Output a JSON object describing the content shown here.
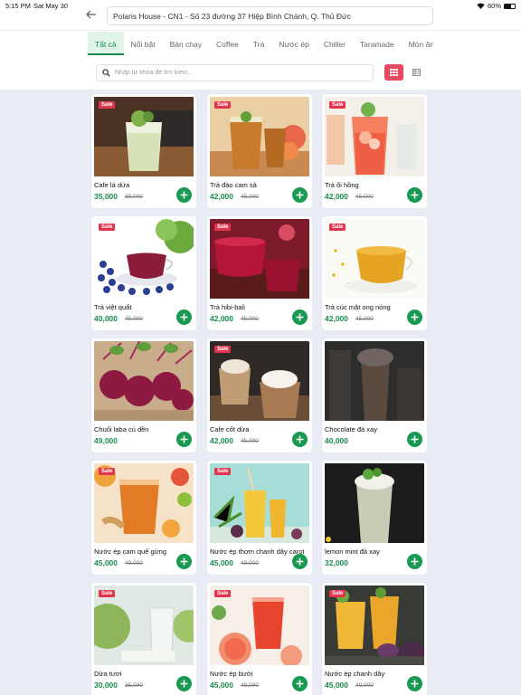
{
  "status_bar": {
    "time": "5:15 PM",
    "date": "Sat May 30",
    "battery": "60%",
    "battery_level": 0.6
  },
  "header": {
    "back_icon": "arrow-left-icon",
    "address": "Polaris House - CN1 - Số 23 đường 37 Hiệp Bình Chánh, Q. Thủ Đức"
  },
  "tabs": [
    {
      "label": "Tất cả",
      "active": true
    },
    {
      "label": "Nổi bật",
      "active": false
    },
    {
      "label": "Bán chạy",
      "active": false
    },
    {
      "label": "Coffee",
      "active": false
    },
    {
      "label": "Trà",
      "active": false
    },
    {
      "label": "Nước ép",
      "active": false
    },
    {
      "label": "Chiller",
      "active": false
    },
    {
      "label": "Taramade",
      "active": false
    },
    {
      "label": "Món ăn",
      "active": false
    }
  ],
  "search": {
    "placeholder": "Nhập từ khóa để tìm kiếm...",
    "value": ""
  },
  "view_toggle": {
    "grid_icon": "grid-view-icon",
    "list_icon": "list-view-icon",
    "active": "grid",
    "active_color": "#e84a60"
  },
  "colors": {
    "accent": "#1a8b4d",
    "sale": "#e2344e",
    "background": "#eaecf5"
  },
  "sale_label": "Sale",
  "products": [
    {
      "name": "Cafe lá dứa",
      "price": "35,000",
      "old_price": "39,000",
      "sale": true,
      "image": "pandan-coffee"
    },
    {
      "name": "Trà đào cam sả",
      "price": "42,000",
      "old_price": "45,000",
      "sale": true,
      "image": "peach-tea"
    },
    {
      "name": "Trà ổi hồng",
      "price": "42,000",
      "old_price": "45,000",
      "sale": true,
      "image": "guava-tea"
    },
    {
      "name": "Trà việt quất",
      "price": "40,000",
      "old_price": "45,000",
      "sale": true,
      "image": "blueberry-tea"
    },
    {
      "name": "Trà hibi-bali",
      "price": "42,000",
      "old_price": "45,000",
      "sale": true,
      "image": "hibiscus-tea"
    },
    {
      "name": "Trà cúc mật ong nóng",
      "price": "42,000",
      "old_price": "45,000",
      "sale": true,
      "image": "chamomile-tea"
    },
    {
      "name": "Chuối laba củ dền",
      "price": "49,000",
      "old_price": "",
      "sale": false,
      "image": "beetroot"
    },
    {
      "name": "Cafe cốt dừa",
      "price": "42,000",
      "old_price": "45,000",
      "sale": true,
      "image": "coconut-coffee"
    },
    {
      "name": "Chocolate đá xay",
      "price": "40,000",
      "old_price": "",
      "sale": false,
      "image": "chocolate-frappe"
    },
    {
      "name": "Nước ép cam quế gừng",
      "price": "45,000",
      "old_price": "49,000",
      "sale": true,
      "image": "orange-ginger-juice"
    },
    {
      "name": "Nước ép thơm chanh dây carot",
      "price": "45,000",
      "old_price": "49,000",
      "sale": true,
      "image": "pineapple-juice"
    },
    {
      "name": "lemon mint đá xay",
      "price": "32,000",
      "old_price": "",
      "sale": false,
      "image": "lemon-mint-frappe"
    },
    {
      "name": "Dừa tươi",
      "price": "30,000",
      "old_price": "35,000",
      "sale": true,
      "image": "fresh-coconut"
    },
    {
      "name": "Nước ép bưởi",
      "price": "45,000",
      "old_price": "49,000",
      "sale": true,
      "image": "grapefruit-juice"
    },
    {
      "name": "Nước ép chanh dây",
      "price": "45,000",
      "old_price": "49,000",
      "sale": true,
      "image": "passion-fruit-juice"
    }
  ]
}
